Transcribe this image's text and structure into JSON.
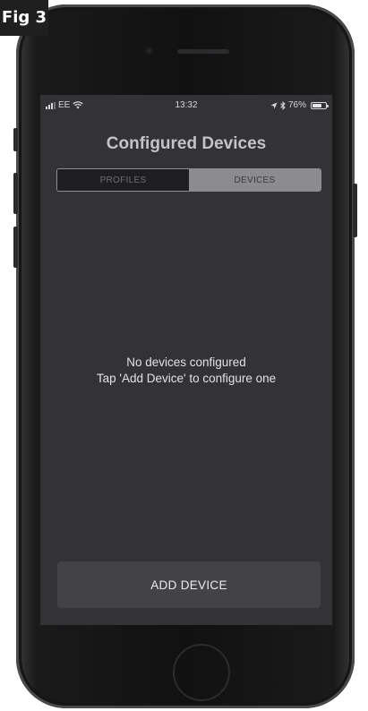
{
  "figure_label": "Fig 3",
  "status_bar": {
    "carrier": "EE",
    "time": "13:32",
    "battery_text": "76%",
    "battery_level": 0.76
  },
  "screen": {
    "title": "Configured Devices",
    "tabs": [
      {
        "label": "PROFILES",
        "active": false
      },
      {
        "label": "DEVICES",
        "active": true
      }
    ],
    "empty_message": {
      "line1": "No devices configured",
      "line2": "Tap 'Add Device' to configure one"
    },
    "add_button_label": "ADD DEVICE"
  },
  "icons": {
    "wifi": "wifi-icon",
    "location": "location-arrow-icon",
    "bluetooth": "bluetooth-icon",
    "battery": "battery-icon",
    "signal": "signal-bars-icon"
  },
  "colors": {
    "screen_bg": "#333335",
    "active_tab": "#8c8c90",
    "inactive_tab": "#1e1e20",
    "button_bg": "#434345"
  }
}
